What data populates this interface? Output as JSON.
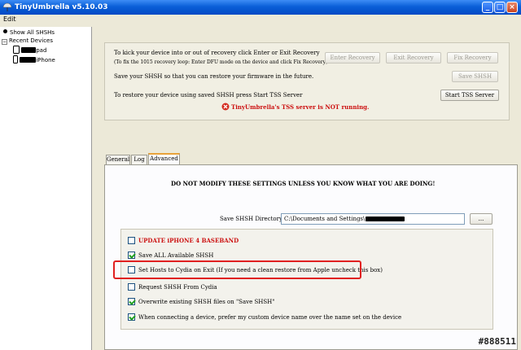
{
  "window": {
    "title": "TinyUmbrella v5.10.03"
  },
  "menu": {
    "edit": "Edit"
  },
  "tree": {
    "show_all": "Show All SHSHs",
    "recent_devices": "Recent Devices",
    "devices": [
      {
        "suffix": "pad"
      },
      {
        "suffix": "iPhone"
      }
    ]
  },
  "top_panel": {
    "line1": "To kick your device into or out of recovery click Enter or Exit Recovery",
    "line2": "(To fix the 1015 recovery loop: Enter DFU mode on the device and click Fix Recovery)",
    "line3": "Save your SHSH so that you can restore your firmware in the future.",
    "line4": "To restore your device using saved SHSH press Start TSS Server",
    "tss_status": "TinyUmbrella's TSS server is NOT running.",
    "buttons": {
      "enter_recovery": "Enter Recovery",
      "exit_recovery": "Exit Recovery",
      "fix_recovery": "Fix Recovery",
      "save_shsh": "Save SHSH",
      "start_tss": "Start TSS Server"
    }
  },
  "tabs": [
    {
      "label": "General"
    },
    {
      "label": "Log"
    },
    {
      "label": "Advanced"
    }
  ],
  "advanced": {
    "warning": "DO NOT MODIFY THESE SETTINGS UNLESS YOU KNOW WHAT YOU ARE DOING!",
    "save_dir_label": "Save SHSH Directory:",
    "save_dir_value": "C:\\Documents and Settings\\",
    "browse_label": "...",
    "options": [
      {
        "label": "UPDATE iPHONE 4 BASEBAND",
        "checked": false
      },
      {
        "label": "Save ALL Available SHSH",
        "checked": true
      },
      {
        "label": "Set Hosts to Cydia on Exit (If you need a clean restore from Apple uncheck this box)",
        "checked": false
      },
      {
        "label": "Request SHSH From Cydia",
        "checked": false
      },
      {
        "label": "Overwrite existing SHSH files on \"Save SHSH\"",
        "checked": true
      },
      {
        "label": "When connecting a device, prefer my custom device name over the name set on the device",
        "checked": true
      }
    ]
  },
  "colors": {
    "warning_red": "#cc1111",
    "titlebar_blue": "#0a5fd8",
    "highlight_red": "#e02020"
  },
  "watermark": "#888511"
}
